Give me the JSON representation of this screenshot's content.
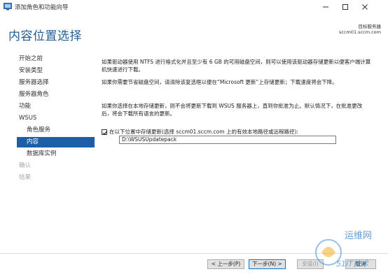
{
  "window": {
    "title": "添加角色和功能向导"
  },
  "header": {
    "page_title": "内容位置选择",
    "target_label": "目标服务器",
    "target_server": "sccm01.sccm.com"
  },
  "nav": {
    "items": [
      {
        "label": "开始之前",
        "state": "normal",
        "level": "top"
      },
      {
        "label": "安装类型",
        "state": "normal",
        "level": "top"
      },
      {
        "label": "服务器选择",
        "state": "normal",
        "level": "top"
      },
      {
        "label": "服务器角色",
        "state": "normal",
        "level": "top"
      },
      {
        "label": "功能",
        "state": "normal",
        "level": "top"
      },
      {
        "label": "WSUS",
        "state": "normal",
        "level": "top"
      },
      {
        "label": "角色服务",
        "state": "normal",
        "level": "sub"
      },
      {
        "label": "内容",
        "state": "active",
        "level": "sub"
      },
      {
        "label": "数据库实例",
        "state": "normal",
        "level": "sub"
      },
      {
        "label": "确认",
        "state": "disabled",
        "level": "top"
      },
      {
        "label": "结果",
        "state": "disabled",
        "level": "top"
      }
    ]
  },
  "content": {
    "para1": "如果驱动器使用 NTFS 进行格式化并且至少有 6 GB 的可用磁盘空间，则可以使用该驱动器存储更新以便客户端计算机快速进行下载。",
    "para2": "如果你需要节省磁盘空间，请清除该复选框以便在“Microsoft 更新”上存储更新；下载速度将会下降。",
    "para3": "如果你选择在本地存储更新，则不会将更新下载到 WSUS 服务器上，直到你批准为止。默认情况下，在批准更改后，将会下载所有语言的更新。",
    "store_checkbox_label": "在以下位置中存储更新(选择 sccm01.sccm.com 上的有效本地路径或远程路径):",
    "store_checked": true,
    "path_value": "D:\\WSUSUpdatepack"
  },
  "footer": {
    "prev_label": "< 上一步(P)",
    "next_label": "下一步(N) >",
    "install_label": "安装(I)",
    "cancel_label": "取消"
  },
  "watermark": {
    "line1": "运维网",
    "line2": "51IT技术"
  }
}
